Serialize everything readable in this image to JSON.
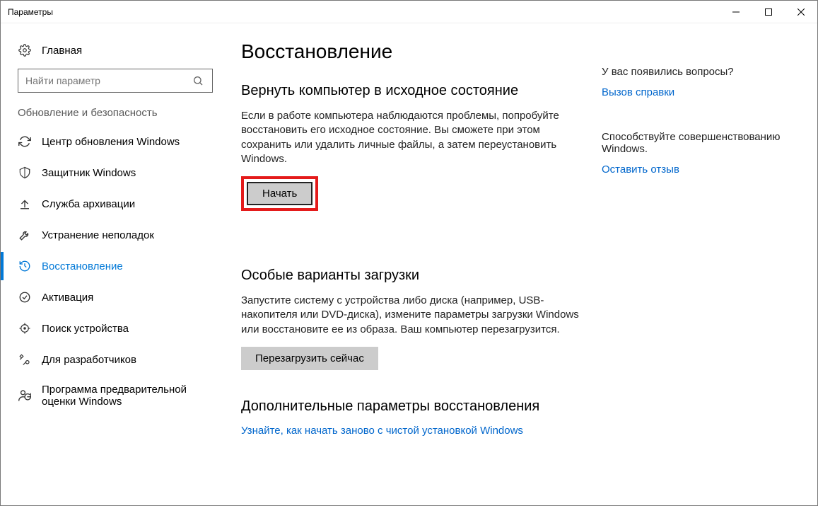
{
  "window": {
    "title": "Параметры"
  },
  "sidebar": {
    "home": "Главная",
    "search_placeholder": "Найти параметр",
    "section_label": "Обновление и безопасность",
    "items": [
      {
        "label": "Центр обновления Windows"
      },
      {
        "label": "Защитник Windows"
      },
      {
        "label": "Служба архивации"
      },
      {
        "label": "Устранение неполадок"
      },
      {
        "label": "Восстановление"
      },
      {
        "label": "Активация"
      },
      {
        "label": "Поиск устройства"
      },
      {
        "label": "Для разработчиков"
      },
      {
        "label": "Программа предварительной оценки Windows"
      }
    ]
  },
  "main": {
    "title": "Восстановление",
    "reset": {
      "heading": "Вернуть компьютер в исходное состояние",
      "desc": "Если в работе компьютера наблюдаются проблемы, попробуйте восстановить его исходное состояние. Вы сможете при этом сохранить или удалить личные файлы, а затем переустановить Windows.",
      "button": "Начать"
    },
    "advanced_boot": {
      "heading": "Особые варианты загрузки",
      "desc": "Запустите систему с устройства либо диска (например, USB-накопителя или DVD-диска), измените параметры загрузки Windows или восстановите ее из образа. Ваш компьютер перезагрузится.",
      "button": "Перезагрузить сейчас"
    },
    "more": {
      "heading": "Дополнительные параметры восстановления",
      "link": "Узнайте, как начать заново с чистой установкой Windows"
    }
  },
  "aside": {
    "questions": {
      "title": "У вас появились вопросы?",
      "link": "Вызов справки"
    },
    "feedback": {
      "title": "Способствуйте совершенствованию Windows.",
      "link": "Оставить отзыв"
    }
  }
}
